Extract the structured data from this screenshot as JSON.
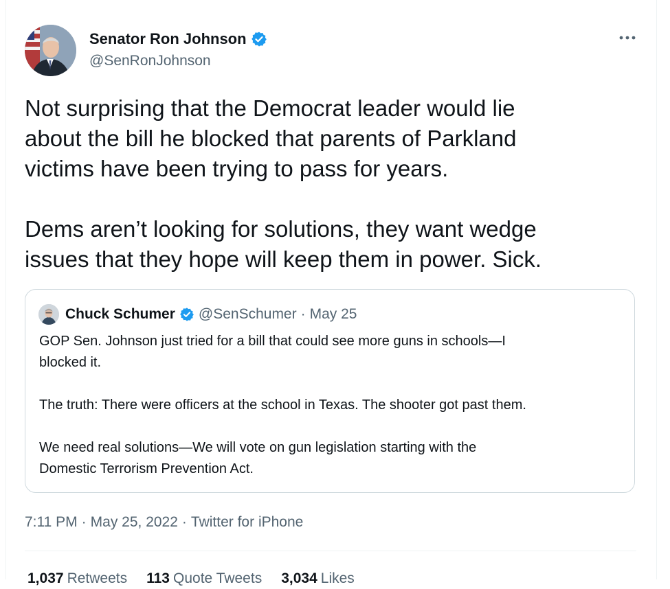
{
  "author": {
    "name": "Senator Ron Johnson",
    "handle": "@SenRonJohnson"
  },
  "tweet": {
    "lines": [
      "Not surprising that the Democrat leader would lie",
      "about the bill he blocked that parents of Parkland",
      "victims have been trying to pass for years.",
      "Dems aren’t looking for solutions, they want wedge",
      "issues that they hope will keep them in power. Sick."
    ]
  },
  "quote": {
    "name": "Chuck Schumer",
    "handle": "@SenSchumer",
    "separator": "·",
    "date": "May 25",
    "lines": [
      "GOP Sen. Johnson just tried for a bill that could see more guns in schools—I",
      "blocked it.",
      "The truth: There were officers at the school in Texas. The shooter got past them.",
      "We need real solutions—We will vote on gun legislation starting with the",
      "Domestic Terrorism Prevention Act."
    ]
  },
  "meta": {
    "time": "7:11 PM",
    "separator": "·",
    "date": "May 25, 2022",
    "source": "Twitter for iPhone"
  },
  "stats": {
    "retweets_count": "1,037",
    "retweets_label": "Retweets",
    "quotes_count": "113",
    "quotes_label": "Quote Tweets",
    "likes_count": "3,034",
    "likes_label": "Likes"
  },
  "colors": {
    "verified": "#1d9bf0",
    "secondary_text": "#536471",
    "border": "#cfd9de"
  },
  "icons": {
    "verified": "verified-badge-icon",
    "more": "more-icon"
  }
}
